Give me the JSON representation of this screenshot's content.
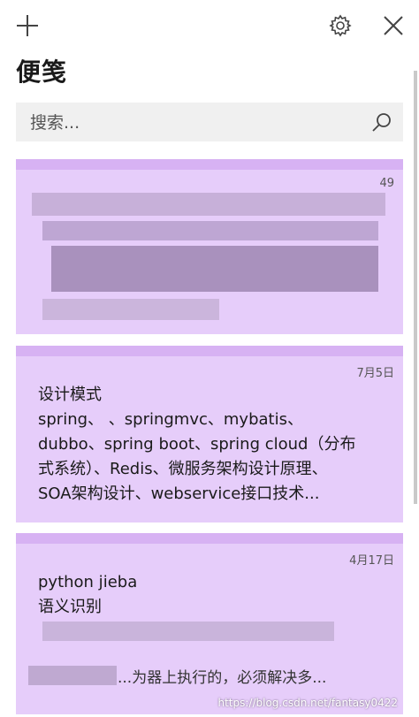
{
  "app": {
    "title": "便笺"
  },
  "search": {
    "placeholder": "搜索..."
  },
  "notes": [
    {
      "date": "49",
      "lines": []
    },
    {
      "date": "7月5日",
      "lines": [
        "设计模式",
        "spring、 、springmvc、mybatis、",
        "dubbo、spring boot、spring cloud（分布",
        "式系统）、Redis、微服务架构设计原理、",
        "SOA架构设计、webservice接口技术..."
      ]
    },
    {
      "date": "4月17日",
      "lines": [
        "python jieba",
        "语义识别",
        "",
        "",
        "...为器上执行的，必须解决多..."
      ]
    }
  ],
  "watermark": "https://blog.csdn.net/fantasy0422",
  "colors": {
    "note_bg": "#e6cdfa",
    "note_strip": "#d7b2f3",
    "search_bg": "#f0f0f0"
  },
  "icons": {
    "add": "plus-icon",
    "settings": "gear-icon",
    "close": "close-icon",
    "search": "search-icon"
  }
}
